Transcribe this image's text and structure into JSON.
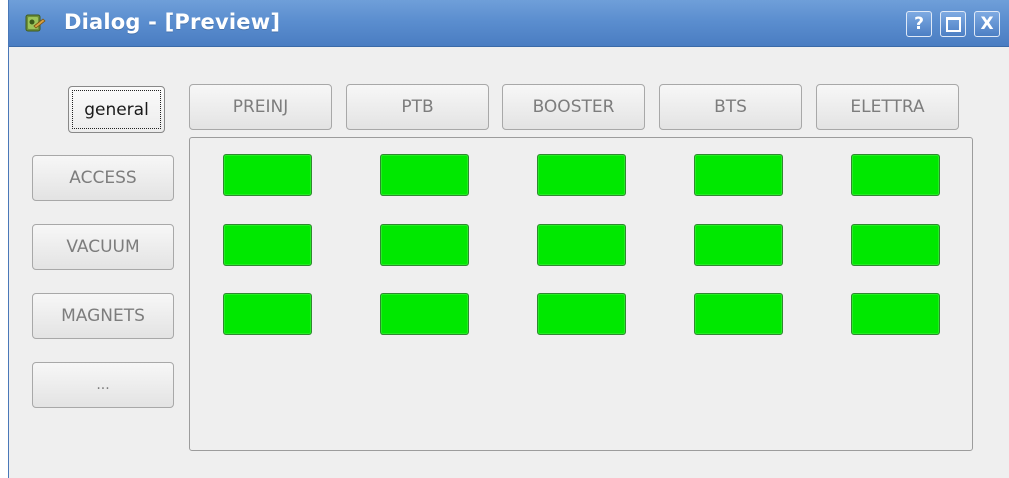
{
  "window": {
    "title": "Dialog - [Preview]",
    "controls": {
      "help_label": "?",
      "maximize_icon": "maximize-icon",
      "close_label": "X"
    }
  },
  "tabs": {
    "top": [
      {
        "label": "PREINJ"
      },
      {
        "label": "PTB"
      },
      {
        "label": "BOOSTER"
      },
      {
        "label": "BTS"
      },
      {
        "label": "ELETTRA"
      }
    ],
    "side": [
      {
        "label": "general",
        "active": true
      },
      {
        "label": "ACCESS"
      },
      {
        "label": "VACUUM"
      },
      {
        "label": "MAGNETS"
      },
      {
        "label": "..."
      }
    ]
  },
  "status_grid": {
    "rows": 3,
    "cols": 5,
    "color": "#00e800",
    "state": "ok"
  },
  "colors": {
    "titlebar": "#5b8ecf",
    "led_on": "#00e800",
    "background": "#efefef"
  }
}
